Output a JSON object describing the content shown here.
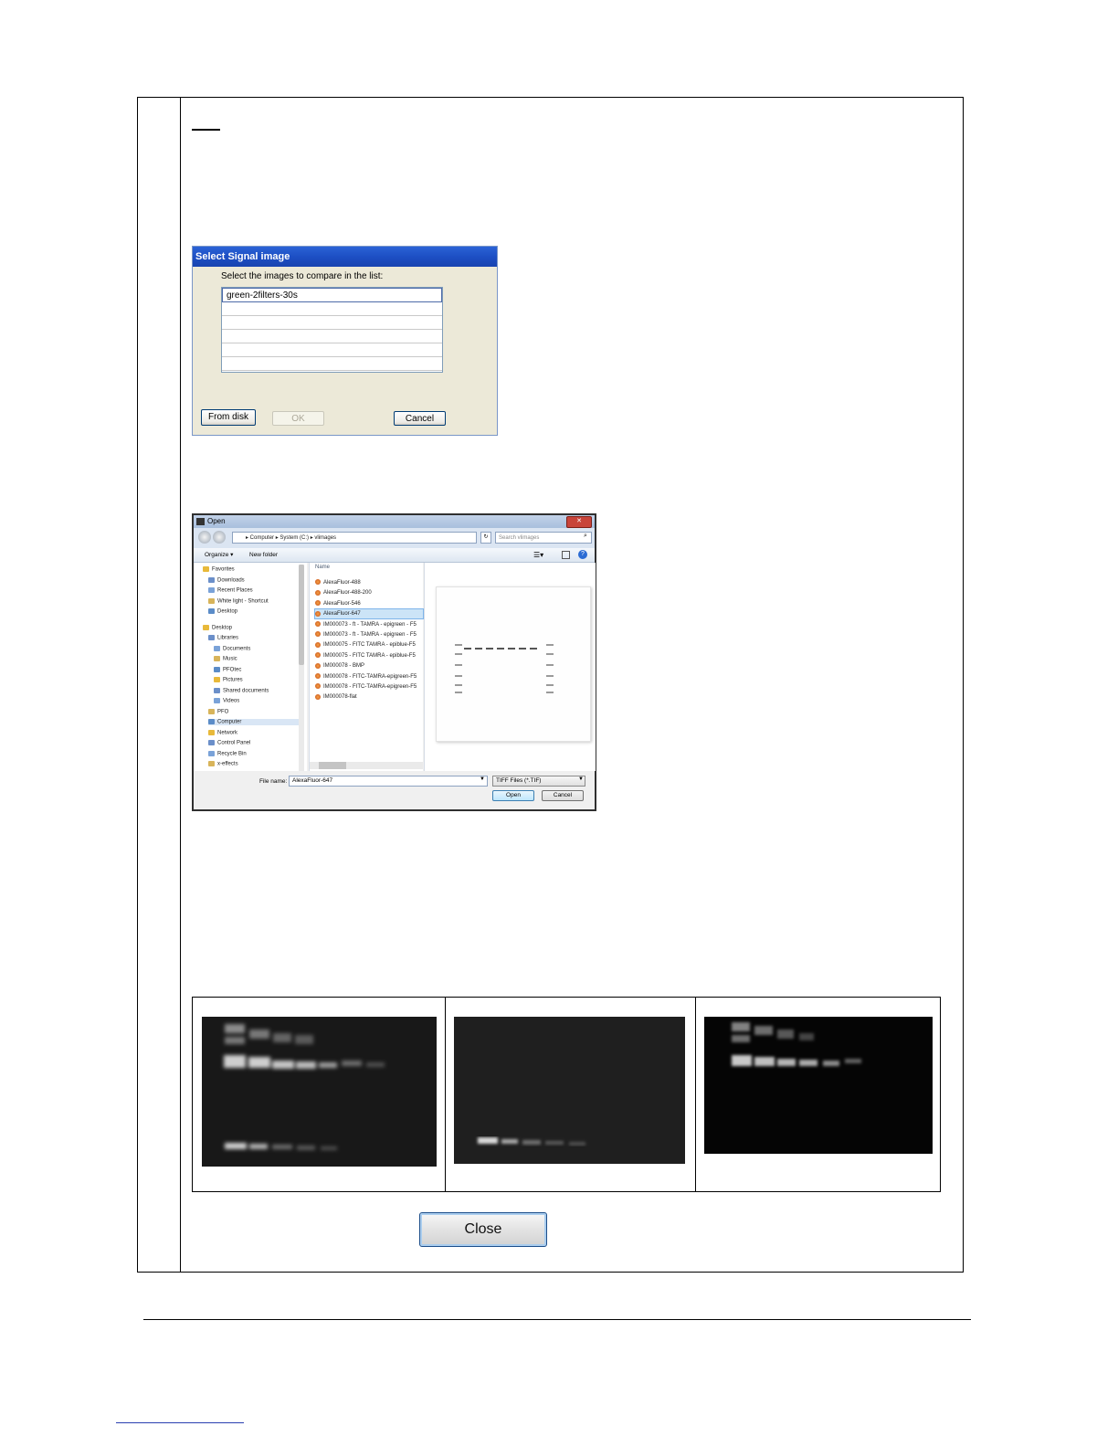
{
  "signal_dialog": {
    "title": "Select Signal image",
    "prompt": "Select the images to compare in the list:",
    "list_items": [
      "green-2filters-30s"
    ],
    "buttons": {
      "from_disk": "From disk",
      "ok": "OK",
      "cancel": "Cancel"
    }
  },
  "open_dialog": {
    "title": "Open",
    "breadcrumb": "▸ Computer ▸ System (C:) ▸ vlimages",
    "search_placeholder": "Search vlimages",
    "toolbar": {
      "organize": "Organize ▾",
      "new_folder": "New folder"
    },
    "nav_items": [
      {
        "label": "Favorites",
        "indent": 0
      },
      {
        "label": "Downloads",
        "indent": 1
      },
      {
        "label": "Recent Places",
        "indent": 1
      },
      {
        "label": "White light - Shortcut",
        "indent": 1
      },
      {
        "label": "Desktop",
        "indent": 1
      },
      {
        "label": "Desktop",
        "indent": 0
      },
      {
        "label": "Libraries",
        "indent": 1
      },
      {
        "label": "Documents",
        "indent": 2
      },
      {
        "label": "Music",
        "indent": 2
      },
      {
        "label": "PFOtec",
        "indent": 2
      },
      {
        "label": "Pictures",
        "indent": 2
      },
      {
        "label": "Shared documents",
        "indent": 2
      },
      {
        "label": "Videos",
        "indent": 2
      },
      {
        "label": "PFO",
        "indent": 1
      },
      {
        "label": "Computer",
        "indent": 1
      },
      {
        "label": "Network",
        "indent": 1
      },
      {
        "label": "Control Panel",
        "indent": 1
      },
      {
        "label": "Recycle Bin",
        "indent": 1
      },
      {
        "label": "x-effects",
        "indent": 1
      }
    ],
    "column_header": "Name",
    "files": [
      "AlexaFluor-488",
      "AlexaFluor-488-200",
      "AlexaFluor-546",
      "AlexaFluor-647",
      "IM000073 - ft - TAMRA - epigreen - F5",
      "IM000073 - ft - TAMRA - epigreen - F5",
      "IM000075 - FITC TAMRA - epiblue-F5",
      "IM000075 - FITC TAMRA - epiblue-F5",
      "IM000078 - BMP",
      "IM000078 - FITC-TAMRA-epigreen-F5",
      "IM000078 - FITC-TAMRA-epigreen-F5",
      "IM000078-flat"
    ],
    "selected_file_index": 3,
    "file_name_label": "File name:",
    "file_name_value": "AlexaFluor-647",
    "file_type": "TIFF Files (*.TIF)",
    "buttons": {
      "open": "Open",
      "cancel": "Cancel"
    }
  },
  "close_button": "Close"
}
